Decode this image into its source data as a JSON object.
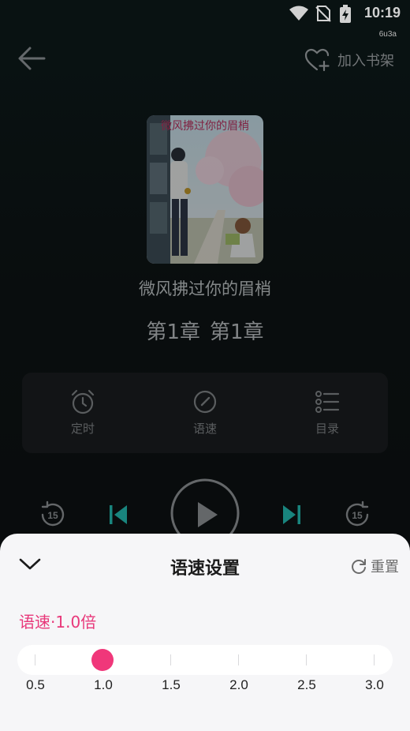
{
  "status_bar": {
    "time": "10:19",
    "sub_label": "6u3a"
  },
  "header": {
    "add_shelf_label": "加入书架"
  },
  "book": {
    "title": "微风拂过你的眉梢",
    "chapter_part1": "第1章",
    "chapter_part2": "第1章",
    "cover_text": "微风拂过你的眉梢"
  },
  "functions": [
    {
      "label": "定时",
      "icon": "alarm-clock-icon"
    },
    {
      "label": "语速",
      "icon": "speedometer-icon"
    },
    {
      "label": "目录",
      "icon": "list-icon"
    }
  ],
  "player": {
    "rewind_seconds": "15",
    "forward_seconds": "15"
  },
  "speed_sheet": {
    "title": "语速设置",
    "reset_label": "重置",
    "current_speed_label": "语速·1.0倍",
    "options": [
      "0.5",
      "1.0",
      "1.5",
      "2.0",
      "2.5",
      "3.0"
    ],
    "selected_value": "1.0"
  },
  "colors": {
    "accent_pink": "#f0377a",
    "teal_icon": "#1fa39a"
  }
}
